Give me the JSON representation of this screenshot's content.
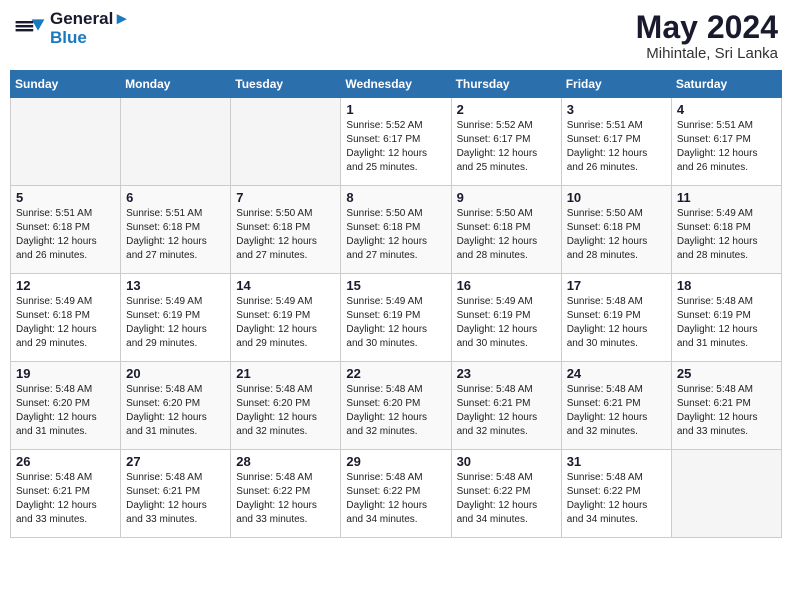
{
  "header": {
    "logo_line1": "General",
    "logo_line2": "Blue",
    "month_title": "May 2024",
    "location": "Mihintale, Sri Lanka"
  },
  "days_of_week": [
    "Sunday",
    "Monday",
    "Tuesday",
    "Wednesday",
    "Thursday",
    "Friday",
    "Saturday"
  ],
  "weeks": [
    [
      {
        "day": "",
        "info": ""
      },
      {
        "day": "",
        "info": ""
      },
      {
        "day": "",
        "info": ""
      },
      {
        "day": "1",
        "info": "Sunrise: 5:52 AM\nSunset: 6:17 PM\nDaylight: 12 hours\nand 25 minutes."
      },
      {
        "day": "2",
        "info": "Sunrise: 5:52 AM\nSunset: 6:17 PM\nDaylight: 12 hours\nand 25 minutes."
      },
      {
        "day": "3",
        "info": "Sunrise: 5:51 AM\nSunset: 6:17 PM\nDaylight: 12 hours\nand 26 minutes."
      },
      {
        "day": "4",
        "info": "Sunrise: 5:51 AM\nSunset: 6:17 PM\nDaylight: 12 hours\nand 26 minutes."
      }
    ],
    [
      {
        "day": "5",
        "info": "Sunrise: 5:51 AM\nSunset: 6:18 PM\nDaylight: 12 hours\nand 26 minutes."
      },
      {
        "day": "6",
        "info": "Sunrise: 5:51 AM\nSunset: 6:18 PM\nDaylight: 12 hours\nand 27 minutes."
      },
      {
        "day": "7",
        "info": "Sunrise: 5:50 AM\nSunset: 6:18 PM\nDaylight: 12 hours\nand 27 minutes."
      },
      {
        "day": "8",
        "info": "Sunrise: 5:50 AM\nSunset: 6:18 PM\nDaylight: 12 hours\nand 27 minutes."
      },
      {
        "day": "9",
        "info": "Sunrise: 5:50 AM\nSunset: 6:18 PM\nDaylight: 12 hours\nand 28 minutes."
      },
      {
        "day": "10",
        "info": "Sunrise: 5:50 AM\nSunset: 6:18 PM\nDaylight: 12 hours\nand 28 minutes."
      },
      {
        "day": "11",
        "info": "Sunrise: 5:49 AM\nSunset: 6:18 PM\nDaylight: 12 hours\nand 28 minutes."
      }
    ],
    [
      {
        "day": "12",
        "info": "Sunrise: 5:49 AM\nSunset: 6:18 PM\nDaylight: 12 hours\nand 29 minutes."
      },
      {
        "day": "13",
        "info": "Sunrise: 5:49 AM\nSunset: 6:19 PM\nDaylight: 12 hours\nand 29 minutes."
      },
      {
        "day": "14",
        "info": "Sunrise: 5:49 AM\nSunset: 6:19 PM\nDaylight: 12 hours\nand 29 minutes."
      },
      {
        "day": "15",
        "info": "Sunrise: 5:49 AM\nSunset: 6:19 PM\nDaylight: 12 hours\nand 30 minutes."
      },
      {
        "day": "16",
        "info": "Sunrise: 5:49 AM\nSunset: 6:19 PM\nDaylight: 12 hours\nand 30 minutes."
      },
      {
        "day": "17",
        "info": "Sunrise: 5:48 AM\nSunset: 6:19 PM\nDaylight: 12 hours\nand 30 minutes."
      },
      {
        "day": "18",
        "info": "Sunrise: 5:48 AM\nSunset: 6:19 PM\nDaylight: 12 hours\nand 31 minutes."
      }
    ],
    [
      {
        "day": "19",
        "info": "Sunrise: 5:48 AM\nSunset: 6:20 PM\nDaylight: 12 hours\nand 31 minutes."
      },
      {
        "day": "20",
        "info": "Sunrise: 5:48 AM\nSunset: 6:20 PM\nDaylight: 12 hours\nand 31 minutes."
      },
      {
        "day": "21",
        "info": "Sunrise: 5:48 AM\nSunset: 6:20 PM\nDaylight: 12 hours\nand 32 minutes."
      },
      {
        "day": "22",
        "info": "Sunrise: 5:48 AM\nSunset: 6:20 PM\nDaylight: 12 hours\nand 32 minutes."
      },
      {
        "day": "23",
        "info": "Sunrise: 5:48 AM\nSunset: 6:21 PM\nDaylight: 12 hours\nand 32 minutes."
      },
      {
        "day": "24",
        "info": "Sunrise: 5:48 AM\nSunset: 6:21 PM\nDaylight: 12 hours\nand 32 minutes."
      },
      {
        "day": "25",
        "info": "Sunrise: 5:48 AM\nSunset: 6:21 PM\nDaylight: 12 hours\nand 33 minutes."
      }
    ],
    [
      {
        "day": "26",
        "info": "Sunrise: 5:48 AM\nSunset: 6:21 PM\nDaylight: 12 hours\nand 33 minutes."
      },
      {
        "day": "27",
        "info": "Sunrise: 5:48 AM\nSunset: 6:21 PM\nDaylight: 12 hours\nand 33 minutes."
      },
      {
        "day": "28",
        "info": "Sunrise: 5:48 AM\nSunset: 6:22 PM\nDaylight: 12 hours\nand 33 minutes."
      },
      {
        "day": "29",
        "info": "Sunrise: 5:48 AM\nSunset: 6:22 PM\nDaylight: 12 hours\nand 34 minutes."
      },
      {
        "day": "30",
        "info": "Sunrise: 5:48 AM\nSunset: 6:22 PM\nDaylight: 12 hours\nand 34 minutes."
      },
      {
        "day": "31",
        "info": "Sunrise: 5:48 AM\nSunset: 6:22 PM\nDaylight: 12 hours\nand 34 minutes."
      },
      {
        "day": "",
        "info": ""
      }
    ]
  ]
}
